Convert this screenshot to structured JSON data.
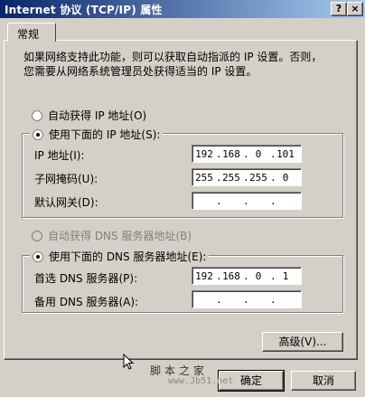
{
  "window": {
    "title": "Internet 协议 (TCP/IP) 属性",
    "help_label": "?",
    "close_label": "×"
  },
  "tabs": [
    {
      "label": "常规"
    }
  ],
  "description": "如果网络支持此功能，则可以获取自动指派的 IP 设置。否则，您需要从网络系统管理员处获得适当的 IP 设置。",
  "ip": {
    "auto_label": "自动获得 IP 地址(O)",
    "manual_label": "使用下面的 IP 地址(S):",
    "selected": "manual",
    "fields": [
      {
        "label": "IP 地址(I):",
        "octets": [
          "192",
          "168",
          "0",
          "101"
        ]
      },
      {
        "label": "子网掩码(U):",
        "octets": [
          "255",
          "255",
          "255",
          "0"
        ]
      },
      {
        "label": "默认网关(D):",
        "octets": [
          "",
          "",
          "",
          ""
        ]
      }
    ]
  },
  "dns": {
    "auto_label": "自动获得 DNS 服务器地址(B)",
    "manual_label": "使用下面的 DNS 服务器地址(E):",
    "selected": "manual",
    "fields": [
      {
        "label": "首选 DNS 服务器(P):",
        "octets": [
          "192",
          "168",
          "0",
          "1"
        ]
      },
      {
        "label": "备用 DNS 服务器(A):",
        "octets": [
          "",
          "",
          "",
          ""
        ]
      }
    ]
  },
  "buttons": {
    "advanced": "高级(V)...",
    "ok": "确定",
    "cancel": "取消"
  },
  "watermark": {
    "line1": "脚本之家",
    "line2": "www.Jb51.net"
  }
}
